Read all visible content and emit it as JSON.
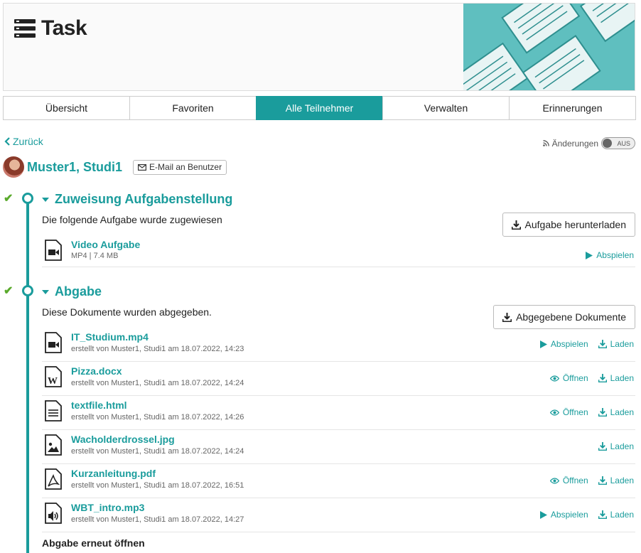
{
  "header": {
    "title": "Task",
    "icon": "task-list-icon"
  },
  "tabs": [
    {
      "label": "Übersicht",
      "active": false
    },
    {
      "label": "Favoriten",
      "active": false
    },
    {
      "label": "Alle Teilnehmer",
      "active": true
    },
    {
      "label": "Verwalten",
      "active": false
    },
    {
      "label": "Erinnerungen",
      "active": false
    }
  ],
  "nav": {
    "back_label": "Zurück",
    "changes_label": "Änderungen",
    "toggle_label": "AUS"
  },
  "user": {
    "name": "Muster1, Studi1",
    "email_button": "E-Mail an Benutzer"
  },
  "assignment": {
    "title": "Zuweisung Aufgabenstellung",
    "description": "Die folgende Aufgabe wurde zugewiesen",
    "button": "Aufgabe herunterladen",
    "file": {
      "name": "Video Aufgabe",
      "meta": "MP4 | 7.4 MB",
      "action": "Abspielen"
    }
  },
  "submission": {
    "title": "Abgabe",
    "description": "Diese Dokumente wurden abgegeben.",
    "button": "Abgegebene Dokumente",
    "files": [
      {
        "name": "IT_Studium.mp4",
        "meta": "erstellt von Muster1, Studi1 am 18.07.2022, 14:23",
        "icon": "video",
        "view": "Abspielen",
        "download": "Laden"
      },
      {
        "name": "Pizza.docx",
        "meta": "erstellt von Muster1, Studi1 am 18.07.2022, 14:24",
        "icon": "word",
        "view": "Öffnen",
        "download": "Laden"
      },
      {
        "name": "textfile.html",
        "meta": "erstellt von Muster1, Studi1 am 18.07.2022, 14:26",
        "icon": "text",
        "view": "Öffnen",
        "download": "Laden"
      },
      {
        "name": "Wacholderdrossel.jpg",
        "meta": "erstellt von Muster1, Studi1 am 18.07.2022, 14:24",
        "icon": "image",
        "view": "",
        "download": "Laden"
      },
      {
        "name": "Kurzanleitung.pdf",
        "meta": "erstellt von Muster1, Studi1 am 18.07.2022, 16:51",
        "icon": "pdf",
        "view": "Öffnen",
        "download": "Laden"
      },
      {
        "name": "WBT_intro.mp3",
        "meta": "erstellt von Muster1, Studi1 am 18.07.2022, 14:27",
        "icon": "audio",
        "view": "Abspielen",
        "download": "Laden"
      }
    ],
    "reopen_label": "Abgabe erneut öffnen"
  },
  "colors": {
    "accent": "#1a9c9c",
    "check": "#5aaa2c"
  }
}
